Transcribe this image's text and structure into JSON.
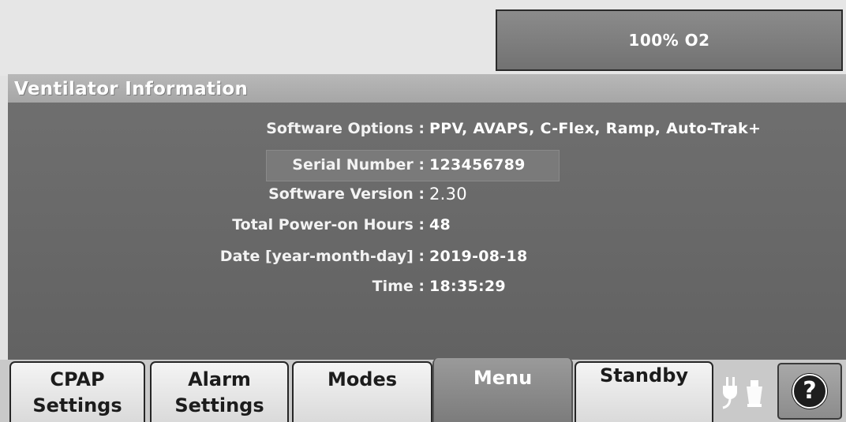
{
  "header": {
    "o2_button_label": "100% O2"
  },
  "panel": {
    "title": "Ventilator Information",
    "rows": [
      {
        "label": "Software Options :",
        "value": "PPV, AVAPS, C-Flex, Ramp, Auto-Trak+"
      },
      {
        "label": "Serial Number :",
        "value": "123456789"
      },
      {
        "label": "Software Version :",
        "value": "2.30"
      },
      {
        "label": "Total Power-on Hours :",
        "value": "48"
      },
      {
        "label": "Date [year-month-day] :",
        "value": "2019-08-18"
      },
      {
        "label": "Time :",
        "value": "18:35:29"
      }
    ]
  },
  "tabs": [
    {
      "line1": "CPAP",
      "line2": "Settings"
    },
    {
      "line1": "Alarm",
      "line2": "Settings"
    },
    {
      "line1": "Modes",
      "line2": ""
    },
    {
      "line1": "Menu",
      "line2": ""
    },
    {
      "line1": "Standby",
      "line2": ""
    }
  ],
  "active_tab": "Menu",
  "icons": {
    "power_status": "ac-power-plug-icon",
    "help": "question-mark-icon",
    "help_glyph": "?"
  },
  "colors": {
    "panel_bg": "#6a6a6a",
    "header_bg": "#b0b0b0",
    "tab_bg": "#e8e8e8",
    "active_tab_bg": "#8a8a8a"
  }
}
